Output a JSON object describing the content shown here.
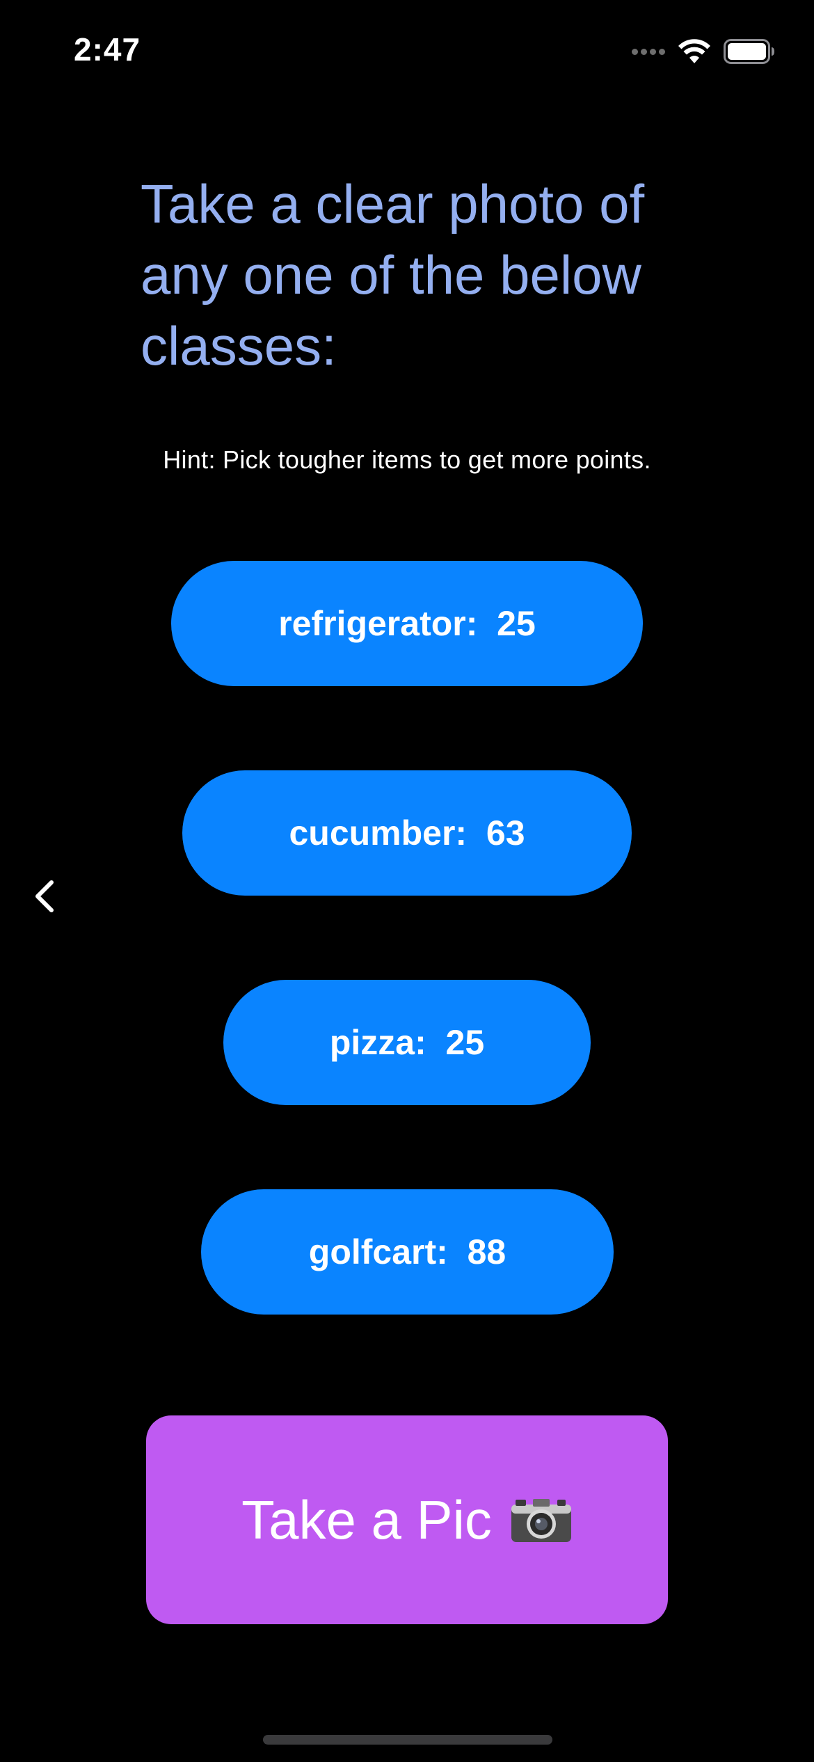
{
  "status_bar": {
    "time": "2:47",
    "icons": [
      "cellular-signal-icon",
      "wifi-icon",
      "battery-icon"
    ]
  },
  "navigation": {
    "back_icon": "chevron-left-icon"
  },
  "title": "Take a clear photo of any one of the below classes:",
  "hint": "Hint: Pick tougher items to get more points.",
  "classes": [
    {
      "name": "refrigerator:",
      "points": "25"
    },
    {
      "name": "cucumber:",
      "points": "63"
    },
    {
      "name": "pizza:",
      "points": "25"
    },
    {
      "name": "golfcart:",
      "points": "88"
    }
  ],
  "take_pic": {
    "label": "Take a Pic",
    "icon": "camera-icon"
  },
  "colors": {
    "background": "#000000",
    "title": "#94aff0",
    "class_button": "#0a84ff",
    "take_pic_button": "#bf5af2"
  }
}
